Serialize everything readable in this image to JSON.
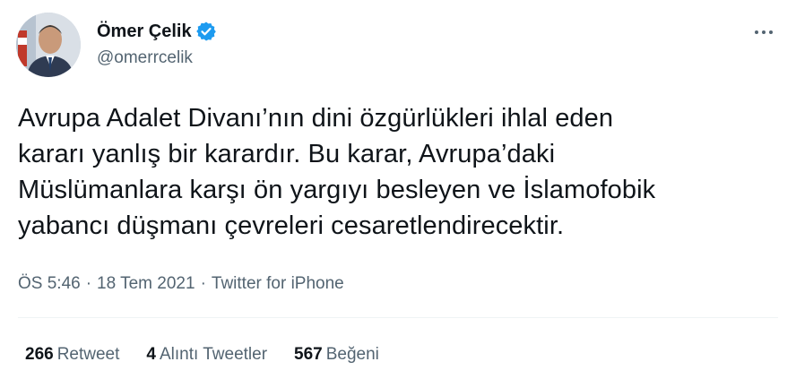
{
  "user": {
    "display_name": "Ömer Çelik",
    "handle": "@omerrcelik",
    "verified_icon": "verified-badge-icon",
    "verified_color": "#1d9bf0"
  },
  "tweet": {
    "text": "Avrupa Adalet Divanı’nın dini özgürlükleri ihlal eden\nkararı yanlış bir karardır. Bu karar, Avrupa’daki\nMüslümanlara karşı ön yargıyı besleyen ve İslamofobik\nyabancı düşmanı çevreleri cesaretlendirecektir."
  },
  "meta": {
    "time": "ÖS 5:46",
    "separator": "·",
    "date": "18 Tem 2021",
    "separator2": "·",
    "source": "Twitter for iPhone"
  },
  "stats": {
    "retweets": {
      "count": "266",
      "label": "Retweet"
    },
    "quotes": {
      "count": "4",
      "label": "Alıntı Tweetler"
    },
    "likes": {
      "count": "567",
      "label": "Beğeni"
    }
  },
  "icons": {
    "more": "more-options-icon"
  },
  "colors": {
    "text": "#0f1419",
    "secondary": "#536471",
    "divider": "#eff3f4",
    "accent": "#1d9bf0"
  }
}
